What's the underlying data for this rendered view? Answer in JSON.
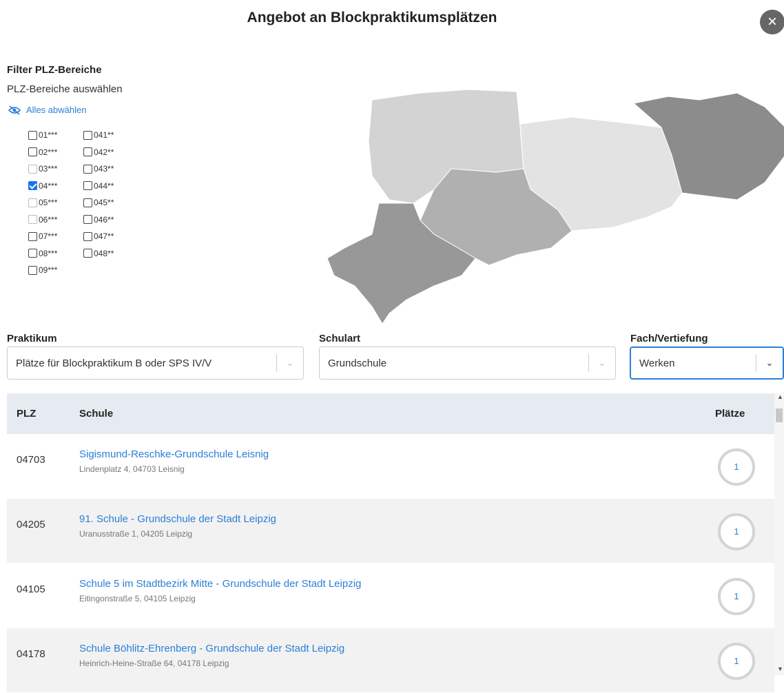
{
  "dialog": {
    "title": "Angebot an Blockpraktikumsplätzen",
    "close": "×"
  },
  "filter": {
    "title": "Filter PLZ-Bereiche",
    "subtitle": "PLZ-Bereiche auswählen",
    "deselect_all": "Alles abwählen",
    "col1": [
      {
        "label": "01***",
        "checked": false,
        "disabled": false
      },
      {
        "label": "02***",
        "checked": false,
        "disabled": false
      },
      {
        "label": "03***",
        "checked": false,
        "disabled": true
      },
      {
        "label": "04***",
        "checked": true,
        "disabled": false
      },
      {
        "label": "05***",
        "checked": false,
        "disabled": true
      },
      {
        "label": "06***",
        "checked": false,
        "disabled": true
      },
      {
        "label": "07***",
        "checked": false,
        "disabled": false
      },
      {
        "label": "08***",
        "checked": false,
        "disabled": false
      },
      {
        "label": "09***",
        "checked": false,
        "disabled": false
      }
    ],
    "col2": [
      {
        "label": "041**",
        "checked": false,
        "disabled": false
      },
      {
        "label": "042**",
        "checked": false,
        "disabled": false
      },
      {
        "label": "043**",
        "checked": false,
        "disabled": false
      },
      {
        "label": "044**",
        "checked": false,
        "disabled": false
      },
      {
        "label": "045**",
        "checked": false,
        "disabled": false
      },
      {
        "label": "046**",
        "checked": false,
        "disabled": false
      },
      {
        "label": "047**",
        "checked": false,
        "disabled": false
      },
      {
        "label": "048**",
        "checked": false,
        "disabled": false
      }
    ]
  },
  "fields": {
    "praktikum": {
      "label": "Praktikum",
      "value": "Plätze für Blockpraktikum B oder SPS IV/V"
    },
    "schulart": {
      "label": "Schulart",
      "value": "Grundschule"
    },
    "fach": {
      "label": "Fach/Vertiefung",
      "value": "Werken"
    }
  },
  "table": {
    "headers": {
      "plz": "PLZ",
      "schule": "Schule",
      "plaetze": "Plätze"
    },
    "rows": [
      {
        "plz": "04703",
        "name": "Sigismund-Reschke-Grundschule Leisnig",
        "address": "Lindenplatz 4, 04703 Leisnig",
        "plaetze": "1"
      },
      {
        "plz": "04205",
        "name": "91. Schule - Grundschule der Stadt Leipzig",
        "address": "Uranusstraße 1, 04205 Leipzig",
        "plaetze": "1"
      },
      {
        "plz": "04105",
        "name": "Schule 5 im Stadtbezirk Mitte - Grundschule der Stadt Leipzig",
        "address": "Eitingonstraße 5, 04105 Leipzig",
        "plaetze": "1"
      },
      {
        "plz": "04178",
        "name": "Schule Böhlitz-Ehrenberg - Grundschule der Stadt Leipzig",
        "address": "Heinrich-Heine-Straße 64, 04178 Leipzig",
        "plaetze": "1"
      }
    ]
  },
  "colors": {
    "accent": "#2b7fd6",
    "header_bg": "#e6ebf1",
    "map_light": "#d3d3d3",
    "map_mid": "#b5b5b5",
    "map_dark": "#8c8c8c"
  }
}
